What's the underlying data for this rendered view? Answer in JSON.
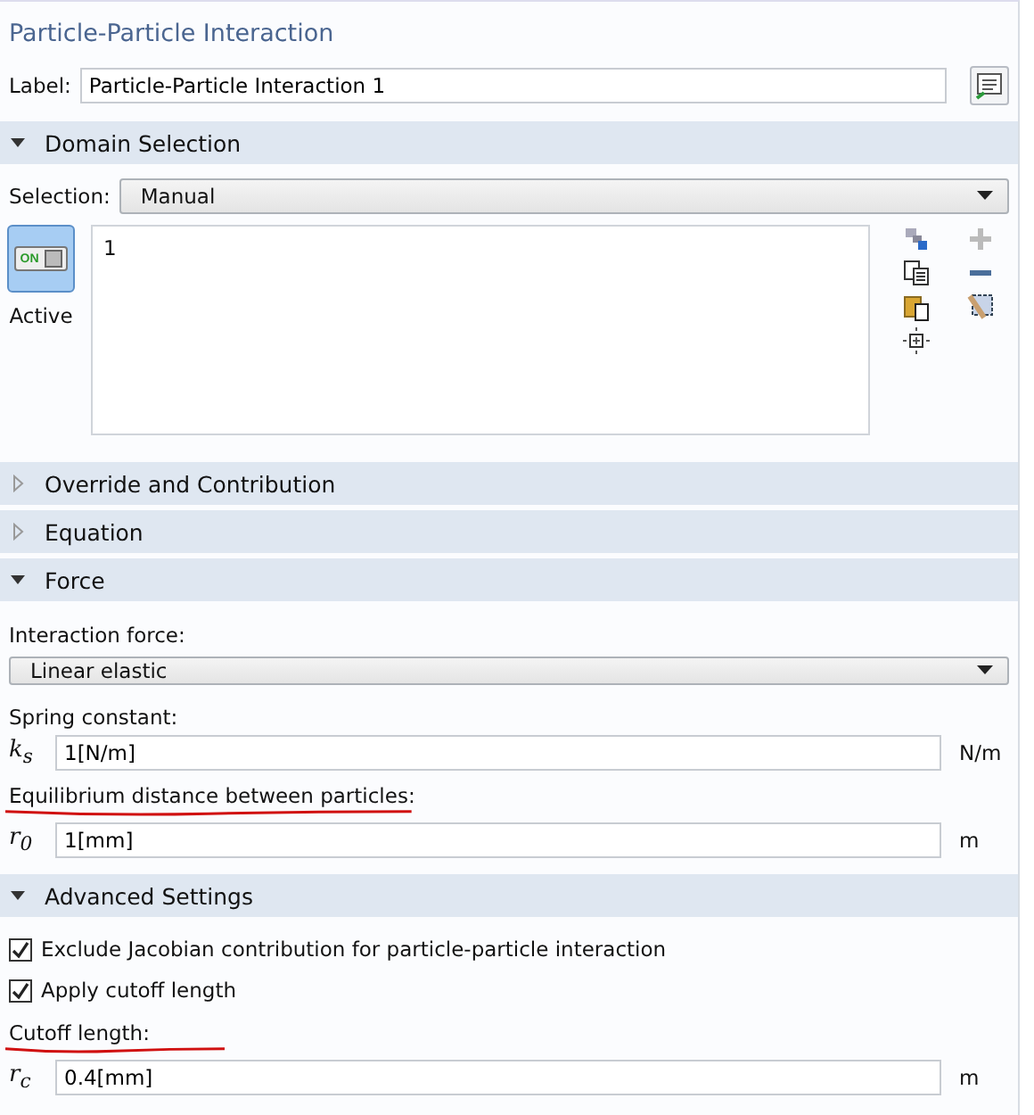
{
  "title": "Particle-Particle Interaction",
  "label": {
    "caption": "Label:",
    "value": "Particle-Particle Interaction 1"
  },
  "sections": [
    {
      "kind": "domain",
      "title": "Domain Selection",
      "expanded": true,
      "selection_caption": "Selection:",
      "selection_value": "Manual",
      "active_switch": {
        "text": "ON",
        "on": true
      },
      "active_caption": "Active",
      "items": [
        "1"
      ]
    },
    {
      "title": "Override and Contribution",
      "expanded": false
    },
    {
      "title": "Equation",
      "expanded": false
    },
    {
      "kind": "force",
      "title": "Force",
      "expanded": true,
      "rows": [
        {
          "kind": "caption",
          "text": "Interaction force:",
          "underlined": false
        },
        {
          "kind": "dropdown",
          "value": "Linear elastic"
        },
        {
          "kind": "caption",
          "text": "Spring constant:",
          "underlined": false
        },
        {
          "kind": "input",
          "symbol": "k$_{s}$",
          "value": "1[N/m]",
          "unit": "N/m"
        },
        {
          "kind": "caption",
          "text": "Equilibrium distance between particles:",
          "underlined": true
        },
        {
          "kind": "input",
          "symbol": "r$_{0}$",
          "value": "1[mm]",
          "unit": "m"
        }
      ]
    },
    {
      "kind": "force",
      "title": "Advanced Settings",
      "expanded": true,
      "rows": [
        {
          "kind": "checkbox",
          "text": "Exclude Jacobian contribution for particle-particle interaction",
          "checked": true
        },
        {
          "kind": "checkbox",
          "text": "Apply cutoff length",
          "checked": true
        },
        {
          "kind": "caption",
          "text": "Cutoff length:",
          "underlined": true
        },
        {
          "kind": "input",
          "symbol": "r$_{c}$",
          "value": "0.4[mm]",
          "unit": "m"
        }
      ]
    }
  ]
}
